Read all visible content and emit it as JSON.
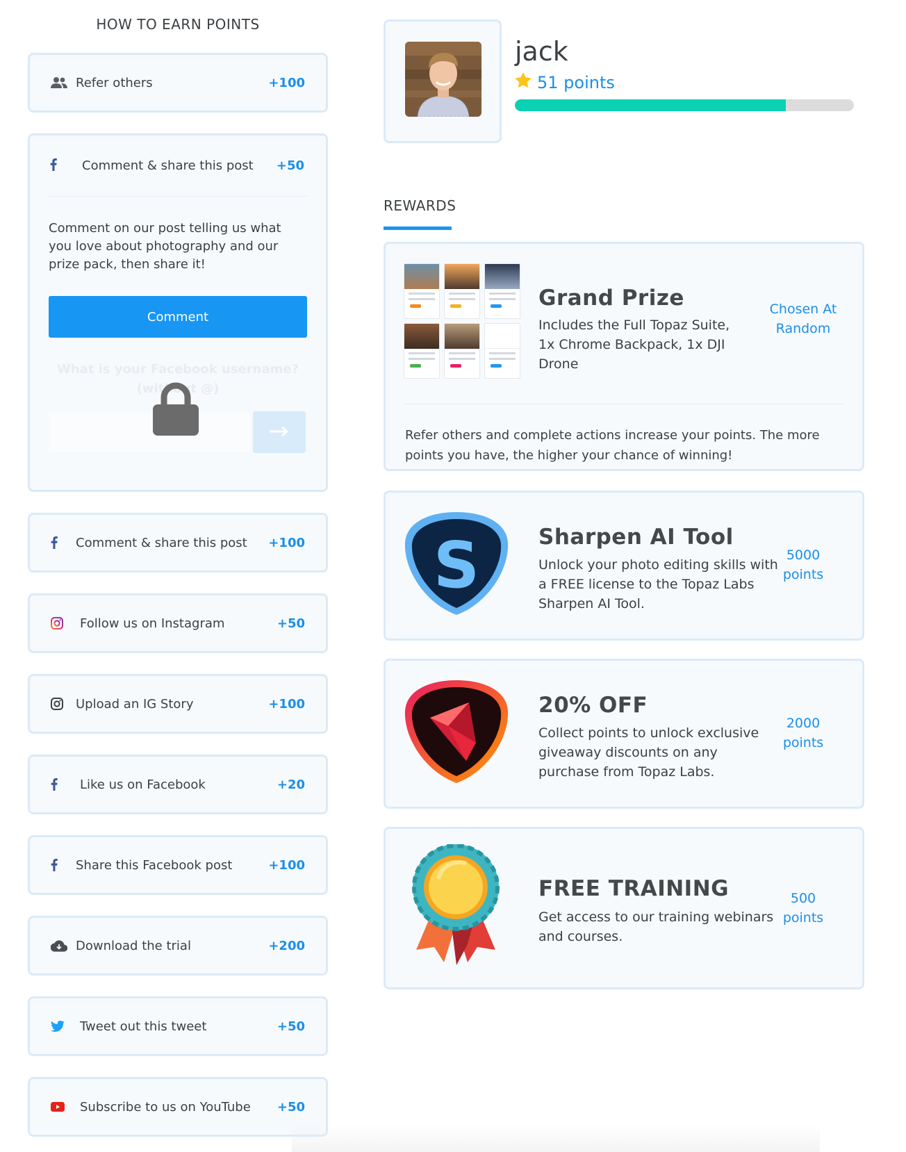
{
  "earn": {
    "title": "HOW TO EARN POINTS",
    "actions_top": {
      "label": "Refer others",
      "points": "+100",
      "icon": "users-icon"
    },
    "expanded": {
      "label": "Comment & share this post",
      "points": "+50",
      "icon": "facebook-icon",
      "description": "Comment on our post telling us what you love about photography and our prize pack, then share it!",
      "button_label": "Comment",
      "input_placeholder": "What is your Facebook username? (without @)"
    },
    "actions": [
      {
        "label": "Comment & share this post",
        "points": "+100",
        "icon": "facebook-icon"
      },
      {
        "label": "Follow us on Instagram",
        "points": "+50",
        "icon": "instagram-icon"
      },
      {
        "label": "Upload an IG Story",
        "points": "+100",
        "icon": "instagram-icon"
      },
      {
        "label": "Like us on Facebook",
        "points": "+20",
        "icon": "facebook-icon"
      },
      {
        "label": "Share this Facebook post",
        "points": "+100",
        "icon": "facebook-icon"
      },
      {
        "label": "Download the trial",
        "points": "+200",
        "icon": "cloud-download-icon"
      },
      {
        "label": "Tweet out this tweet",
        "points": "+50",
        "icon": "twitter-icon"
      },
      {
        "label": "Subscribe to us on YouTube",
        "points": "+50",
        "icon": "youtube-icon"
      }
    ]
  },
  "profile": {
    "name": "jack",
    "points_text": "51 points",
    "progress_fraction": 0.8,
    "star_icon": "star-icon"
  },
  "rewards": {
    "tab_label": "REWARDS",
    "items": [
      {
        "title": "Grand Prize",
        "description": "Includes the Full Topaz Suite, 1x Chrome Backpack, 1x DJI Drone",
        "cost_line1": "Chosen At",
        "cost_line2": "Random",
        "footer": "Refer others and complete actions increase your points. The more points you have, the higher your chance of winning!"
      },
      {
        "title": "Sharpen AI Tool",
        "description": "Unlock your photo editing skills with a FREE license to the Topaz Labs Sharpen AI Tool.",
        "cost_line1": "5000",
        "cost_line2": "points"
      },
      {
        "title": "20% OFF",
        "description": "Collect points to unlock exclusive giveaway discounts on any purchase from Topaz Labs.",
        "cost_line1": "2000",
        "cost_line2": "points"
      },
      {
        "title": "FREE TRAINING",
        "description": "Get access to our training webinars and courses.",
        "cost_line1": "500",
        "cost_line2": "points"
      }
    ]
  },
  "colors": {
    "accent": "#1a8fe8",
    "button": "#1796f4",
    "progress": "#0ad1b3",
    "card_border": "#dbeaf8",
    "card_bg": "#f7fafd"
  }
}
